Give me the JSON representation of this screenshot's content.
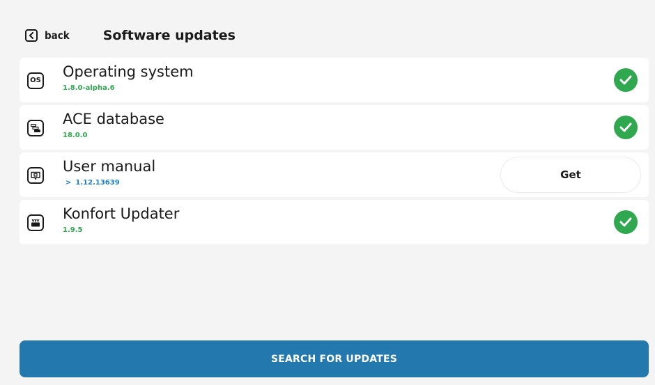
{
  "header": {
    "back_label": "back",
    "title": "Software updates"
  },
  "items": [
    {
      "icon": "os-icon",
      "name": "Operating system",
      "version": "1.8.0-alpha.6",
      "status": "up-to-date"
    },
    {
      "icon": "database-icon",
      "name": "ACE database",
      "version": "18.0.0",
      "status": "up-to-date"
    },
    {
      "icon": "manual-icon",
      "name": "User manual",
      "version": "1.12.13639",
      "status": "update-available",
      "action_label": "Get"
    },
    {
      "icon": "updater-icon",
      "name": "Konfort Updater",
      "version": "1.9.5",
      "status": "up-to-date"
    }
  ],
  "icon_labels": {
    "os": "OS"
  },
  "footer": {
    "search_label": "SEARCH FOR UPDATES"
  },
  "colors": {
    "accent": "#2378ad",
    "success": "#2fa84f",
    "link": "#1f7fc0",
    "background": "#f4f4f5",
    "card": "#ffffff"
  }
}
